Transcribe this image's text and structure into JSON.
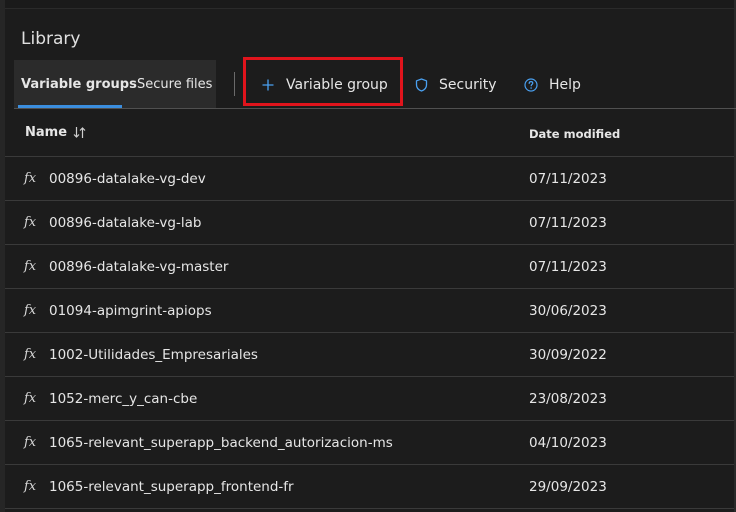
{
  "page": {
    "title": "Library"
  },
  "tabs": [
    {
      "label": "Variable groups",
      "active": true
    },
    {
      "label": "Secure files",
      "active": false
    }
  ],
  "commands": {
    "variable_group": {
      "label": "Variable group",
      "icon": "plus-icon"
    },
    "security": {
      "label": "Security",
      "icon": "shield-icon"
    },
    "help": {
      "label": "Help",
      "icon": "help-circle-icon"
    }
  },
  "table": {
    "columns": {
      "name": "Name",
      "date_modified": "Date modified"
    },
    "rows": [
      {
        "icon": "fx",
        "name": "00896-datalake-vg-dev",
        "date": "07/11/2023"
      },
      {
        "icon": "fx",
        "name": "00896-datalake-vg-lab",
        "date": "07/11/2023"
      },
      {
        "icon": "fx",
        "name": "00896-datalake-vg-master",
        "date": "07/11/2023"
      },
      {
        "icon": "fx",
        "name": "01094-apimgrint-apiops",
        "date": "30/06/2023"
      },
      {
        "icon": "fx",
        "name": "1002-Utilidades_Empresariales",
        "date": "30/09/2022"
      },
      {
        "icon": "fx",
        "name": "1052-merc_y_can-cbe",
        "date": "23/08/2023"
      },
      {
        "icon": "fx",
        "name": "1065-relevant_superapp_backend_autorizacion-ms",
        "date": "04/10/2023"
      },
      {
        "icon": "fx",
        "name": "1065-relevant_superapp_frontend-fr",
        "date": "29/09/2023"
      }
    ]
  },
  "colors": {
    "accent": "#3b8ede",
    "highlight": "#e0141c",
    "background": "#1c1c1c"
  }
}
